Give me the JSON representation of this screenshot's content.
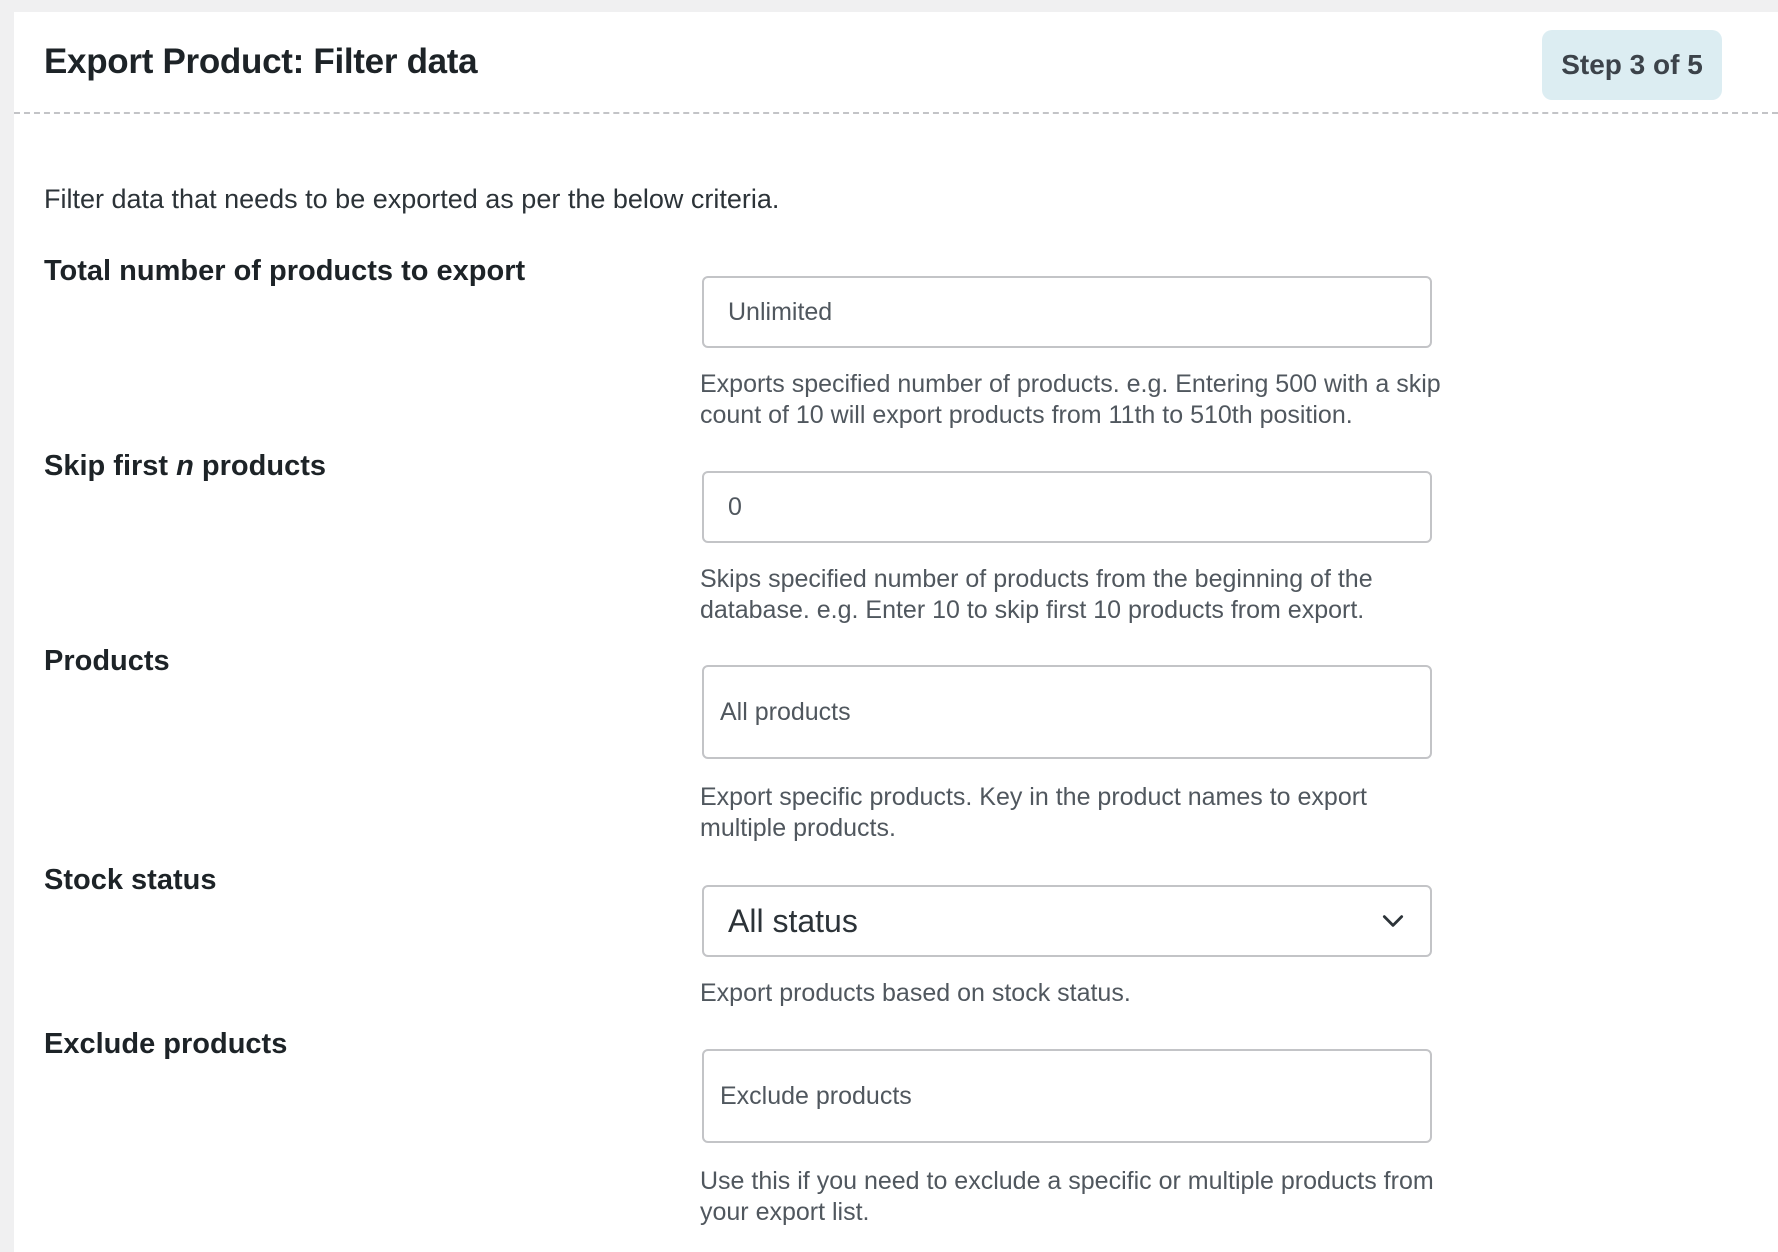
{
  "header": {
    "title": "Export Product: Filter data",
    "step": "Step 3 of 5"
  },
  "intro": "Filter data that needs to be exported as per the below criteria.",
  "fields": {
    "total": {
      "label": "Total number of products to export",
      "placeholder": "Unlimited",
      "help": "Exports specified number of products. e.g. Entering 500 with a skip count of 10 will export products from 11th to 510th position."
    },
    "skip": {
      "label_prefix": "Skip first ",
      "label_var": "n",
      "label_suffix": " products",
      "value": "0",
      "help": "Skips specified number of products from the beginning of the database. e.g. Enter 10 to skip first 10 products from export."
    },
    "products": {
      "label": "Products",
      "placeholder": "All products",
      "help": "Export specific products. Key in the product names to export multiple products."
    },
    "stock": {
      "label": "Stock status",
      "selected": "All status",
      "help": "Export products based on stock status."
    },
    "exclude": {
      "label": "Exclude products",
      "placeholder": "Exclude products",
      "help": "Use this if you need to exclude a specific or multiple products from your export list."
    }
  },
  "icons": {
    "stock_select": "chevron-down-icon"
  }
}
